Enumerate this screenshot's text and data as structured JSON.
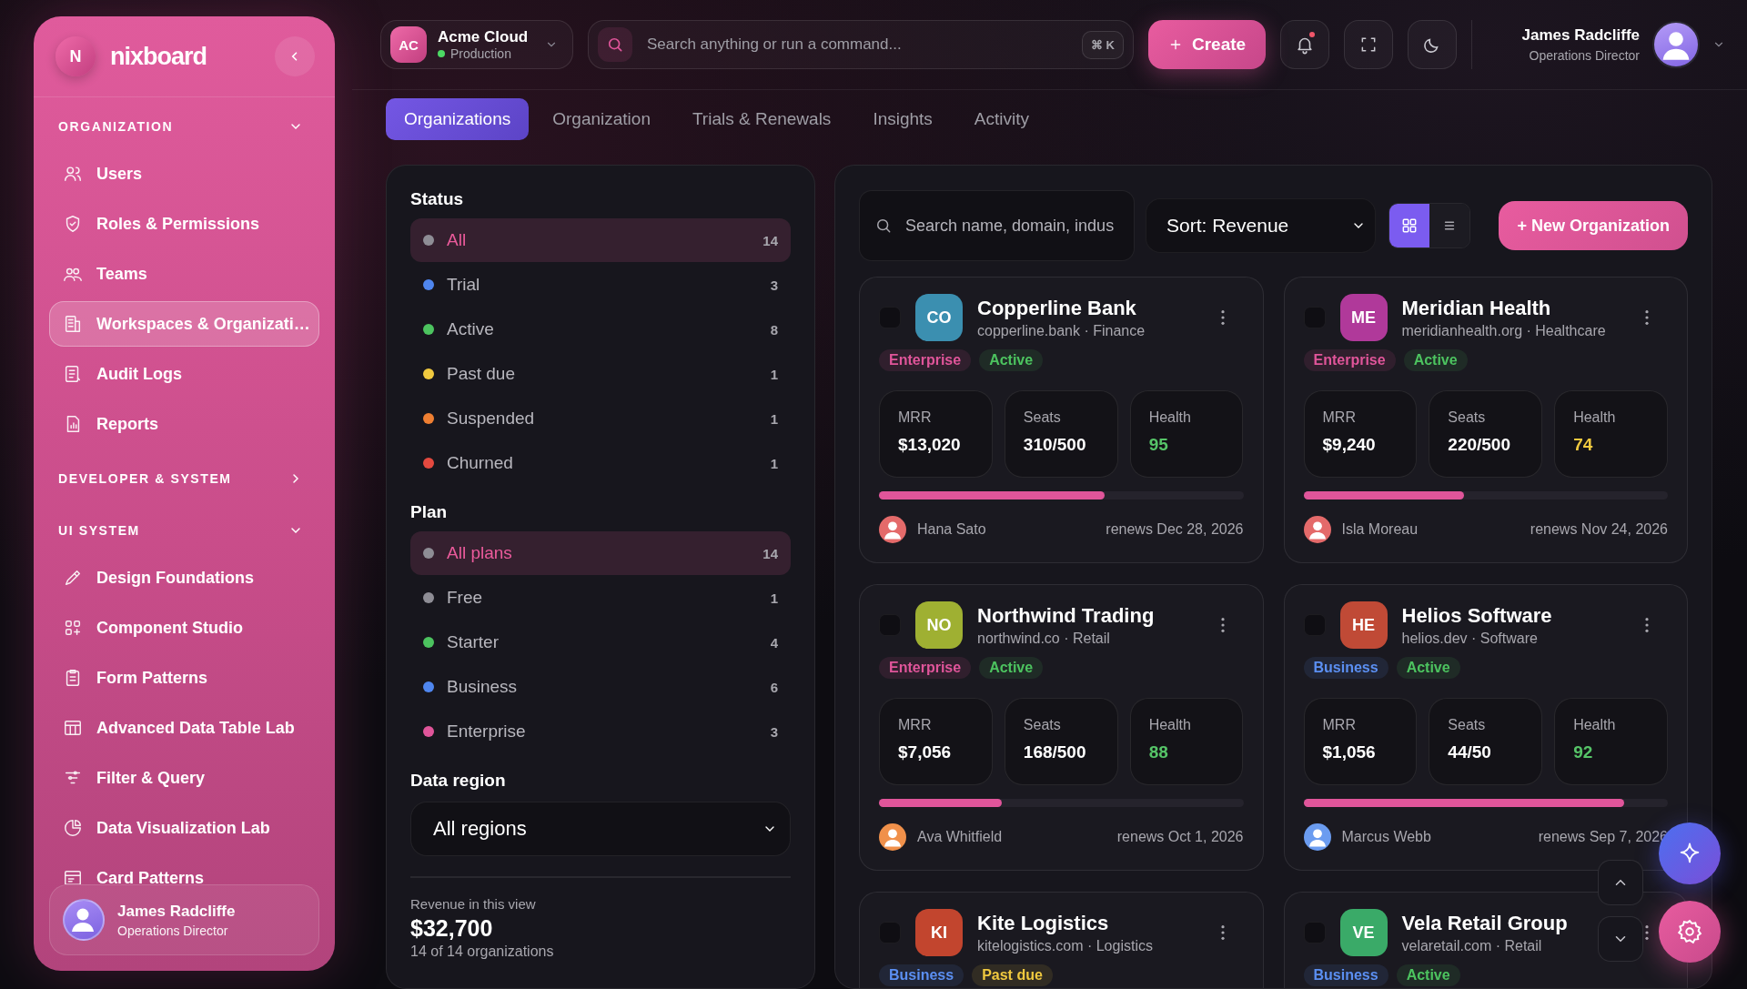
{
  "sidebar": {
    "logo_letter": "N",
    "brand": "nixboard",
    "groups": [
      {
        "title": "ORGANIZATION",
        "expanded": true,
        "items": [
          {
            "label": "Users",
            "selected": false
          },
          {
            "label": "Roles & Permissions",
            "selected": false
          },
          {
            "label": "Teams",
            "selected": false
          },
          {
            "label": "Workspaces & Organizati…",
            "selected": true
          },
          {
            "label": "Audit Logs",
            "selected": false
          },
          {
            "label": "Reports",
            "selected": false
          }
        ]
      },
      {
        "title": "DEVELOPER & SYSTEM",
        "expanded": false
      },
      {
        "title": "UI SYSTEM",
        "expanded": true,
        "items": [
          {
            "label": "Design Foundations",
            "selected": false
          },
          {
            "label": "Component Studio",
            "selected": false
          },
          {
            "label": "Form Patterns",
            "selected": false
          },
          {
            "label": "Advanced Data Table Lab",
            "selected": false
          },
          {
            "label": "Filter & Query",
            "selected": false
          },
          {
            "label": "Data Visualization Lab",
            "selected": false
          },
          {
            "label": "Card Patterns",
            "selected": false
          }
        ]
      }
    ],
    "user": {
      "name": "James Radcliffe",
      "role": "Operations Director"
    }
  },
  "topbar": {
    "workspace": {
      "initials": "AC",
      "name": "Acme Cloud",
      "env": "Production"
    },
    "search": {
      "placeholder": "Search anything or run a command...",
      "shortcut": "⌘ K"
    },
    "create_label": "Create",
    "notification": true,
    "user": {
      "name": "James Radcliffe",
      "role": "Operations Director"
    }
  },
  "tabs": [
    {
      "label": "Organizations",
      "selected": true
    },
    {
      "label": "Organization",
      "selected": false
    },
    {
      "label": "Trials & Renewals",
      "selected": false
    },
    {
      "label": "Insights",
      "selected": false
    },
    {
      "label": "Activity",
      "selected": false
    }
  ],
  "filters": {
    "sections": [
      {
        "title": "Status",
        "items": [
          {
            "label": "All",
            "count": "14",
            "color": "#8e8d95",
            "selected": true
          },
          {
            "label": "Trial",
            "count": "3",
            "color": "#4f86ef",
            "selected": false
          },
          {
            "label": "Active",
            "count": "8",
            "color": "#4cc35f",
            "selected": false
          },
          {
            "label": "Past due",
            "count": "1",
            "color": "#f0c93f",
            "selected": false
          },
          {
            "label": "Suspended",
            "count": "1",
            "color": "#ef7f32",
            "selected": false
          },
          {
            "label": "Churned",
            "count": "1",
            "color": "#e4493f",
            "selected": false
          }
        ]
      },
      {
        "title": "Plan",
        "items": [
          {
            "label": "All plans",
            "count": "14",
            "color": "#8e8d95",
            "selected": true
          },
          {
            "label": "Free",
            "count": "1",
            "color": "#8e8d95",
            "selected": false
          },
          {
            "label": "Starter",
            "count": "4",
            "color": "#4cc35f",
            "selected": false
          },
          {
            "label": "Business",
            "count": "6",
            "color": "#4f86ef",
            "selected": false
          },
          {
            "label": "Enterprise",
            "count": "3",
            "color": "#e0559a",
            "selected": false
          }
        ]
      }
    ],
    "region": {
      "title": "Data region",
      "value": "All regions"
    },
    "summary": {
      "label": "Revenue in this view",
      "value": "$32,700",
      "note": "14 of 14 organizations"
    }
  },
  "toolbar": {
    "search_placeholder": "Search name, domain, indus",
    "sort": "Sort: Revenue",
    "views": [
      {
        "kind": "grid",
        "selected": true
      },
      {
        "kind": "list",
        "selected": false
      }
    ],
    "new_label": "+ New Organization"
  },
  "organizations": [
    {
      "initials": "CO",
      "color": "#3b8fb0",
      "name": "Copperline Bank",
      "subtitle": "copperline.bank · Finance",
      "checked": false,
      "tags": [
        {
          "label": "Enterprise",
          "color": "#e0559a"
        },
        {
          "label": "Active",
          "color": "#4cc35f"
        }
      ],
      "metrics": [
        {
          "label": "MRR",
          "value": "$13,020"
        },
        {
          "label": "Seats",
          "value": "310/500"
        },
        {
          "label": "Health",
          "value": "95",
          "color": "#56c468"
        }
      ],
      "level": 0.62,
      "owner": {
        "name": "Hana Sato",
        "color": "#e46a6a"
      },
      "renews": "renews Dec 28, 2026"
    },
    {
      "initials": "ME",
      "color": "#b0399a",
      "name": "Meridian Health",
      "subtitle": "meridianhealth.org · Healthcare",
      "checked": false,
      "tags": [
        {
          "label": "Enterprise",
          "color": "#e0559a"
        },
        {
          "label": "Active",
          "color": "#4cc35f"
        }
      ],
      "metrics": [
        {
          "label": "MRR",
          "value": "$9,240"
        },
        {
          "label": "Seats",
          "value": "220/500"
        },
        {
          "label": "Health",
          "value": "74",
          "color": "#f0c93f"
        }
      ],
      "level": 0.44,
      "owner": {
        "name": "Isla Moreau",
        "color": "#e46a6a"
      },
      "renews": "renews Nov 24, 2026"
    },
    {
      "initials": "NO",
      "color": "#9fb032",
      "name": "Northwind Trading",
      "subtitle": "northwind.co · Retail",
      "checked": false,
      "tags": [
        {
          "label": "Enterprise",
          "color": "#e0559a"
        },
        {
          "label": "Active",
          "color": "#4cc35f"
        }
      ],
      "metrics": [
        {
          "label": "MRR",
          "value": "$7,056"
        },
        {
          "label": "Seats",
          "value": "168/500"
        },
        {
          "label": "Health",
          "value": "88",
          "color": "#56c468"
        }
      ],
      "level": 0.336,
      "owner": {
        "name": "Ava Whitfield",
        "color": "#f0904a"
      },
      "renews": "renews Oct 1, 2026"
    },
    {
      "initials": "HE",
      "color": "#c04a36",
      "name": "Helios Software",
      "subtitle": "helios.dev · Software",
      "checked": false,
      "tags": [
        {
          "label": "Business",
          "color": "#5b8ff2"
        },
        {
          "label": "Active",
          "color": "#4cc35f"
        }
      ],
      "metrics": [
        {
          "label": "MRR",
          "value": "$1,056"
        },
        {
          "label": "Seats",
          "value": "44/50"
        },
        {
          "label": "Health",
          "value": "92",
          "color": "#56c468"
        }
      ],
      "level": 0.88,
      "owner": {
        "name": "Marcus Webb",
        "color": "#6b9cf0"
      },
      "renews": "renews Sep 7, 2026"
    },
    {
      "initials": "KI",
      "color": "#c2452e",
      "name": "Kite Logistics",
      "subtitle": "kitelogistics.com · Logistics",
      "checked": false,
      "tags": [
        {
          "label": "Business",
          "color": "#5b8ff2"
        },
        {
          "label": "Past due",
          "color": "#f0c93f"
        }
      ]
    },
    {
      "initials": "VE",
      "color": "#3aaa68",
      "name": "Vela Retail Group",
      "subtitle": "velaretail.com · Retail",
      "checked": false,
      "tags": [
        {
          "label": "Business",
          "color": "#5b8ff2"
        },
        {
          "label": "Active",
          "color": "#4cc35f"
        }
      ]
    }
  ]
}
